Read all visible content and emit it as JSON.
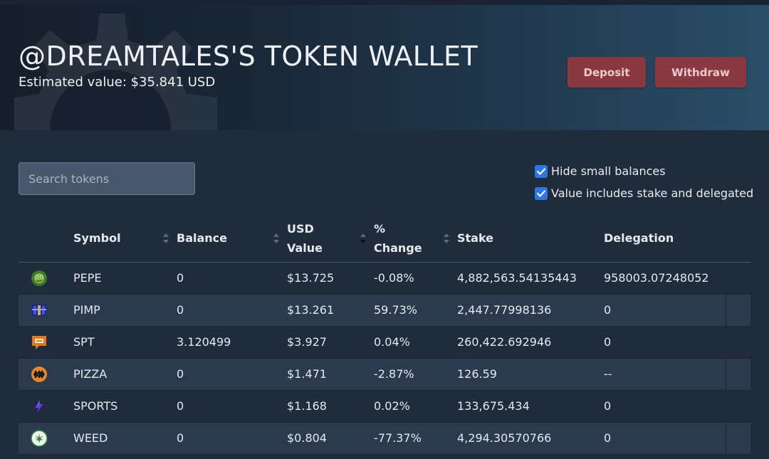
{
  "header": {
    "title": "@DREAMTALES'S TOKEN WALLET",
    "estimated_value": "Estimated value: $35.841 USD",
    "deposit_label": "Deposit",
    "withdraw_label": "Withdraw"
  },
  "search": {
    "placeholder": "Search tokens",
    "value": ""
  },
  "options": {
    "hide_small_balances": {
      "label": "Hide small balances",
      "checked": true
    },
    "value_includes_stake": {
      "label": "Value includes stake and delegated",
      "checked": true
    }
  },
  "table": {
    "columns": {
      "symbol": "Symbol",
      "balance": "Balance",
      "usd_value_1": "USD",
      "usd_value_2": "Value",
      "change_1": "%",
      "change_2": "Change",
      "stake": "Stake",
      "delegation": "Delegation"
    },
    "sorted_column": "USD Value",
    "sort_direction": "descending",
    "rows": [
      {
        "icon": "pepe-frog-icon",
        "symbol": "PEPE",
        "balance": "0",
        "usd_value": "$13.725",
        "change": "-0.08%",
        "trend": "negative",
        "stake": "4,882,563.54135443",
        "delegation": "958003.07248052"
      },
      {
        "icon": "pimp-icon",
        "symbol": "PIMP",
        "balance": "0",
        "usd_value": "$13.261",
        "change": "59.73%",
        "trend": "positive",
        "stake": "2,447.77998136",
        "delegation": "0"
      },
      {
        "icon": "spt-chat-icon",
        "symbol": "SPT",
        "balance": "3.120499",
        "usd_value": "$3.927",
        "change": "0.04%",
        "trend": "positive",
        "stake": "260,422.692946",
        "delegation": "0"
      },
      {
        "icon": "pizza-hive-icon",
        "symbol": "PIZZA",
        "balance": "0",
        "usd_value": "$1.471",
        "change": "-2.87%",
        "trend": "negative",
        "stake": "126.59",
        "delegation": "--"
      },
      {
        "icon": "sports-bolt-icon",
        "symbol": "SPORTS",
        "balance": "0",
        "usd_value": "$1.168",
        "change": "0.02%",
        "trend": "positive",
        "stake": "133,675.434",
        "delegation": "0"
      },
      {
        "icon": "weed-leaf-icon",
        "symbol": "WEED",
        "balance": "0",
        "usd_value": "$0.804",
        "change": "-77.37%",
        "trend": "negative",
        "stake": "4,294.30570766",
        "delegation": "0"
      }
    ]
  },
  "colors": {
    "background": "#202b3c",
    "button": "#8a3841",
    "checkbox": "#2a78e4",
    "negative": "#e34a55",
    "positive": "#3bbf63"
  }
}
